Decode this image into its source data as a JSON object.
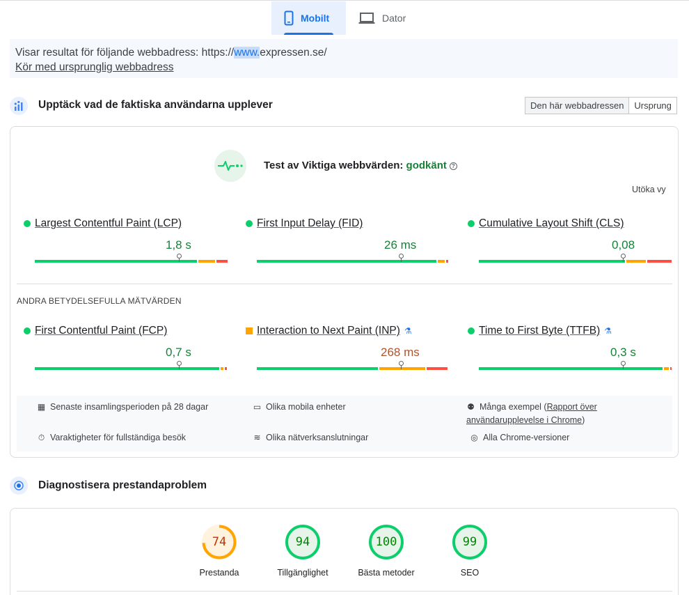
{
  "tabs": [
    {
      "label": "Mobilt",
      "icon": "phone-icon",
      "active": true
    },
    {
      "label": "Dator",
      "icon": "laptop-icon",
      "active": false
    }
  ],
  "notice": {
    "prefix": "Visar resultat för följande webbadress: https://",
    "highlight": "www.",
    "suffix": "expressen.se/",
    "link": "Kör med ursprunglig webbadress"
  },
  "field": {
    "title": "Upptäck vad de faktiska användarna upplever",
    "toggle": [
      "Den här webbadressen",
      "Ursprung"
    ],
    "assessment_label": "Test av Viktiga webbvärden:",
    "assessment_result": "godkänt",
    "expand": "Utöka vy",
    "core_metrics": [
      {
        "name": "Largest Contentful Paint (LCP)",
        "value": "1,8 s",
        "status": "good"
      },
      {
        "name": "First Input Delay (FID)",
        "value": "26 ms",
        "status": "good"
      },
      {
        "name": "Cumulative Layout Shift (CLS)",
        "value": "0,08",
        "status": "good"
      }
    ],
    "other_heading": "ANDRA BETYDELSEFULLA MÄTVÄRDEN",
    "other_metrics": [
      {
        "name": "First Contentful Paint (FCP)",
        "value": "0,7 s",
        "status": "good"
      },
      {
        "name": "Interaction to Next Paint (INP)",
        "value": "268 ms",
        "status": "needs-improvement",
        "experimental": true
      },
      {
        "name": "Time to First Byte (TTFB)",
        "value": "0,3 s",
        "status": "good",
        "experimental": true
      }
    ],
    "info": {
      "period": "Senaste insamlingsperioden på 28 dagar",
      "devices": "Olika mobila enheter",
      "samples_prefix": "Många exempel (",
      "samples_link_1": "Rapport över",
      "samples_link_2": "användarupplevelse i Chrome",
      "samples_suffix": ")",
      "durations": "Varaktigheter för fullständiga besök",
      "network": "Olika nätverksanslutningar",
      "versions": "Alla Chrome-versioner"
    }
  },
  "diagnose": {
    "title": "Diagnostisera prestandaproblem",
    "scores": [
      {
        "value": "74",
        "label": "Prestanda",
        "score": 74,
        "color": "#ffa400"
      },
      {
        "value": "94",
        "label": "Tillgänglighet",
        "score": 94,
        "color": "#0cce6b"
      },
      {
        "value": "100",
        "label": "Bästa metoder",
        "score": 100,
        "color": "#0cce6b"
      },
      {
        "value": "99",
        "label": "SEO",
        "score": 99,
        "color": "#0cce6b"
      }
    ]
  }
}
